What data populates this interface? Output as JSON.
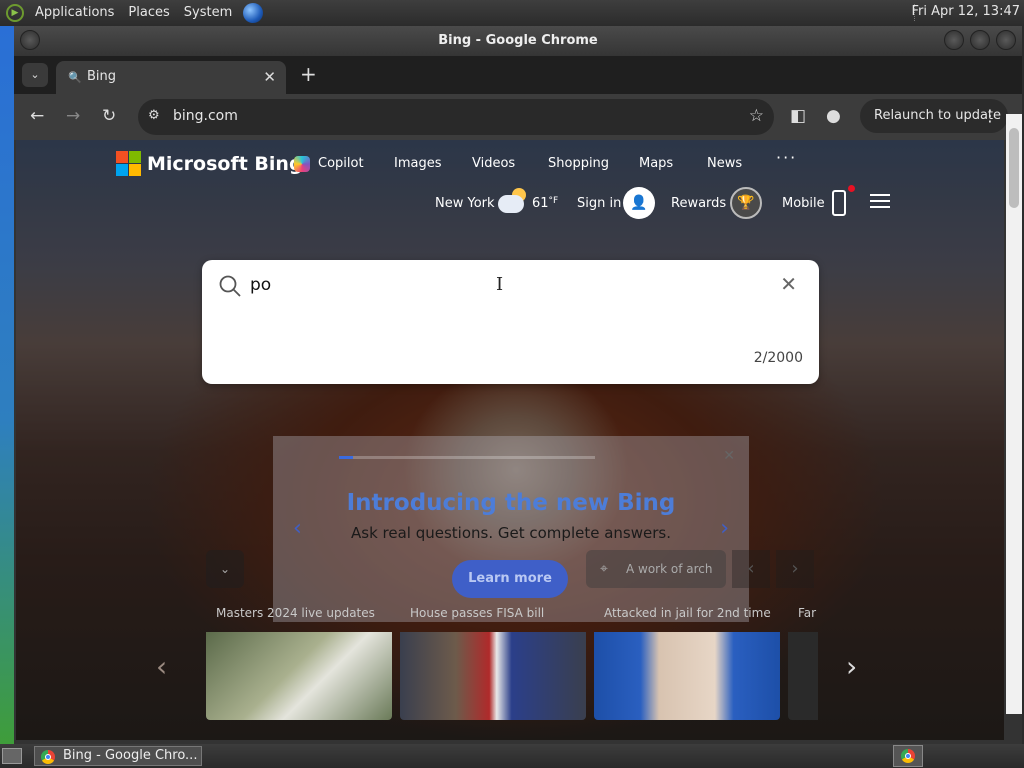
{
  "top_panel": {
    "menus": [
      "Applications",
      "Places",
      "System"
    ],
    "clock": "Fri Apr 12, 13:47"
  },
  "window": {
    "title": "Bing - Google Chrome"
  },
  "browser": {
    "tab_title": "Bing",
    "url": "bing.com",
    "relaunch_label": "Relaunch to update"
  },
  "bing": {
    "brand": "Microsoft Bing",
    "nav": [
      "Copilot",
      "Images",
      "Videos",
      "Shopping",
      "Maps",
      "News"
    ],
    "more": "···",
    "location": "New York",
    "temperature": "61",
    "temp_unit": "°F",
    "sign_in": "Sign in",
    "rewards": "Rewards",
    "mobile": "Mobile",
    "search": {
      "value": "po",
      "char_count": "2/2000"
    },
    "promo": {
      "title": "Introducing the new Bing",
      "subtitle": "Ask real questions. Get complete answers.",
      "button": "Learn more"
    },
    "image_location": "A work of arch",
    "news": [
      {
        "title": "Masters 2024 live updates"
      },
      {
        "title": "House passes FISA bill"
      },
      {
        "title": "Attacked in jail for 2nd time"
      },
      {
        "title": "Far"
      }
    ]
  },
  "taskbar": {
    "window_label": "Bing - Google Chro..."
  }
}
